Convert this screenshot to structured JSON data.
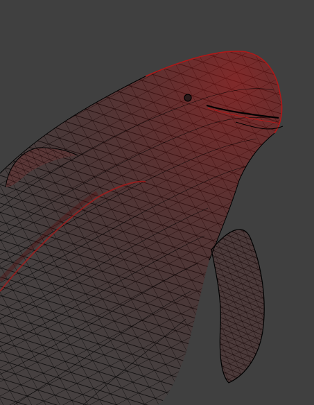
{
  "viewport": {
    "background": "#404040",
    "subject": "dolphin-wireframe-mesh",
    "wire_dark": "#000000",
    "wire_accent": "#b01818"
  }
}
